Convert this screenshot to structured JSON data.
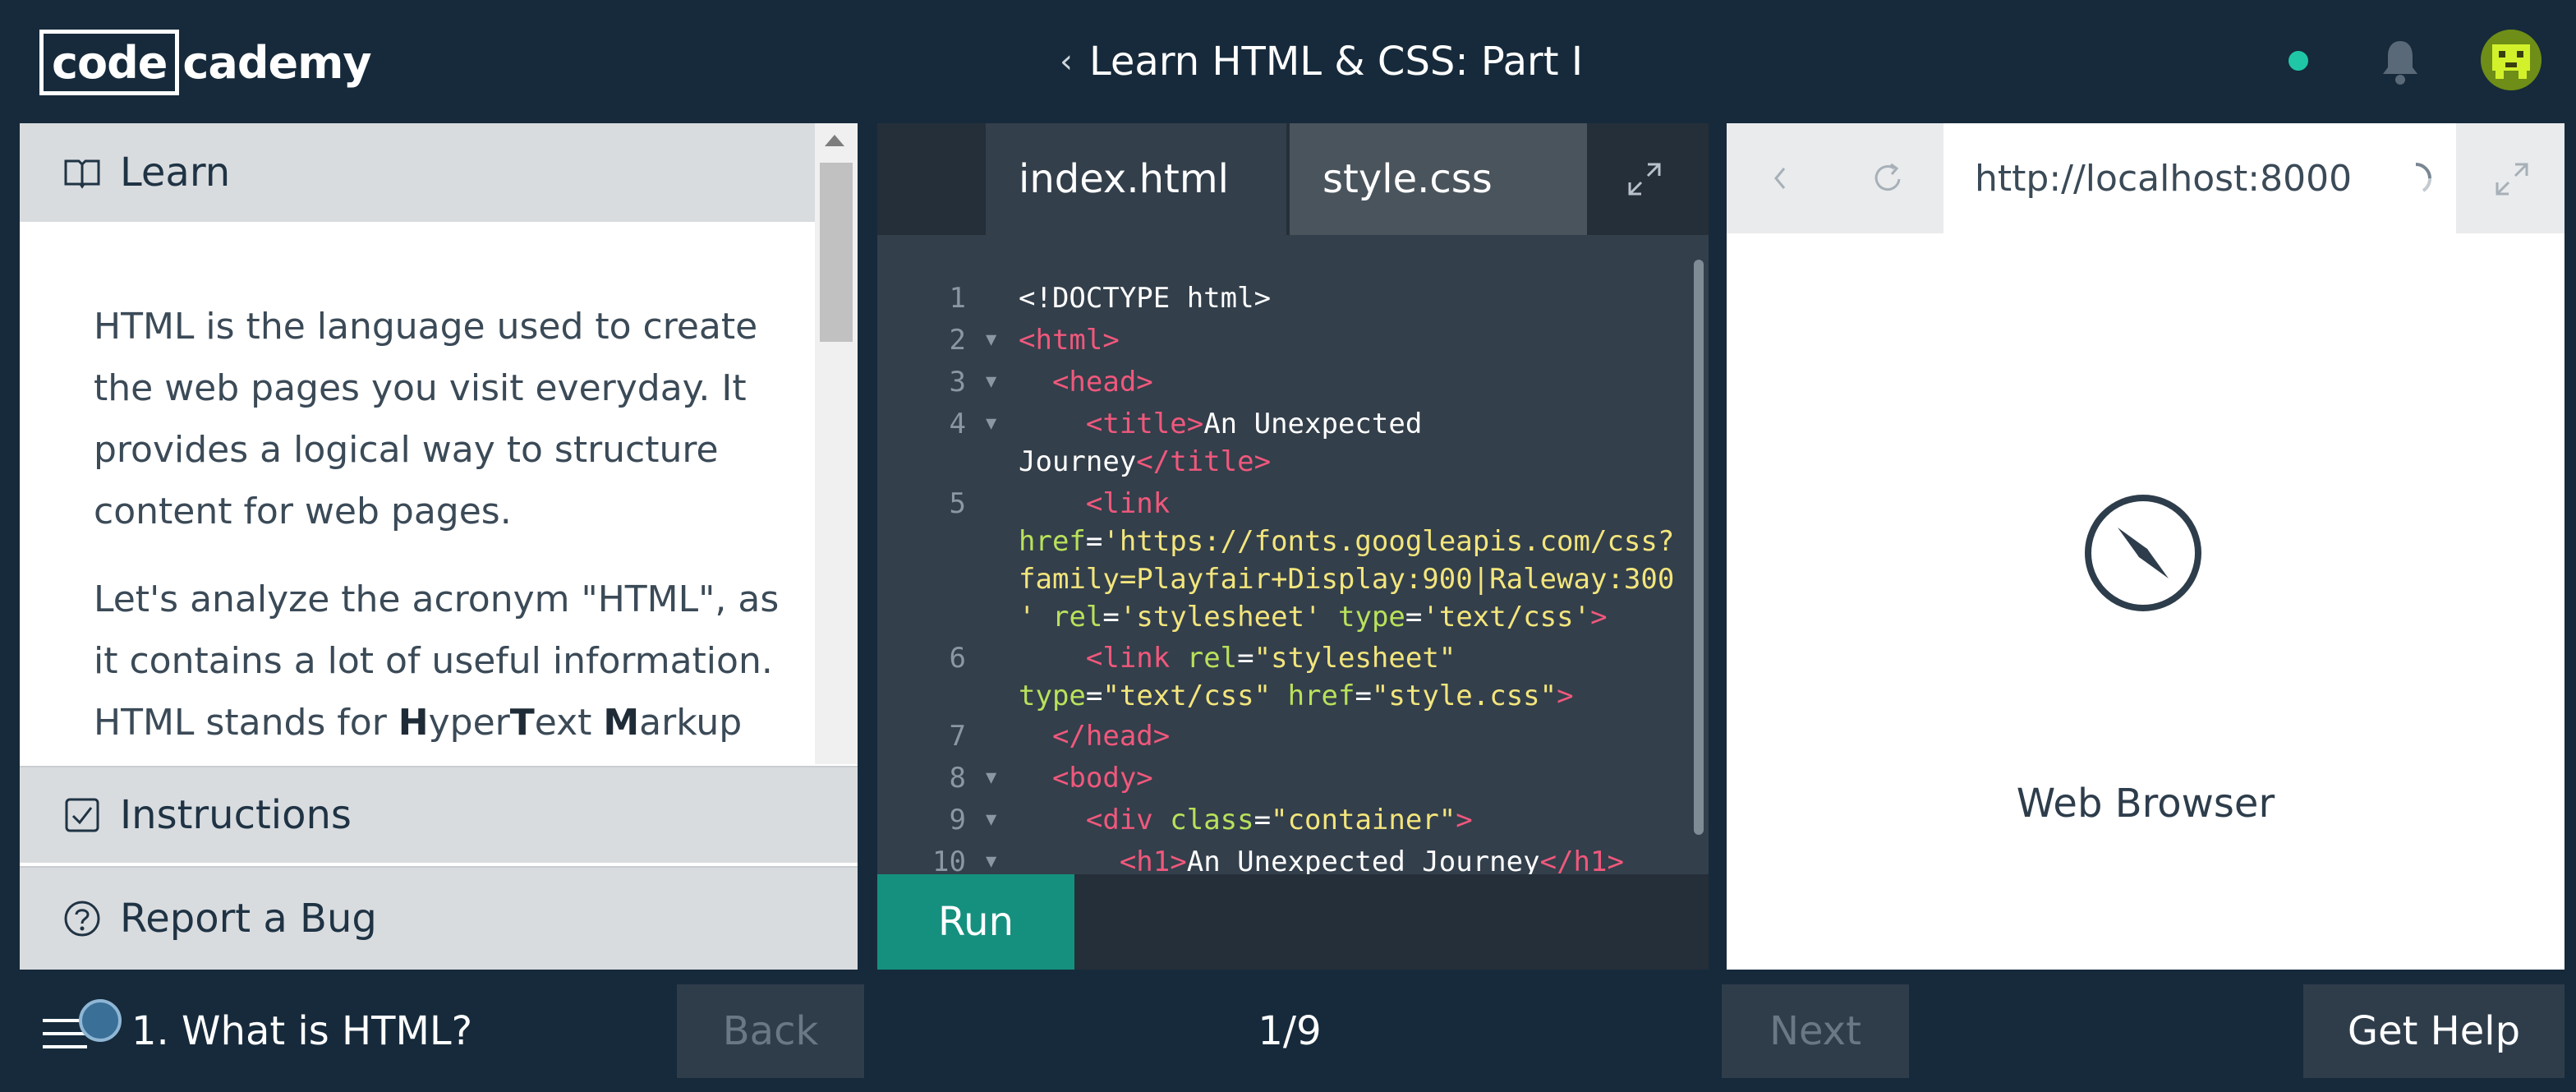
{
  "header": {
    "logo_boxed": "code",
    "logo_rest": "cademy",
    "course_title": "Learn HTML & CSS: Part I",
    "chevron": "‹",
    "icons": [
      "status-dot",
      "bell-icon",
      "avatar"
    ]
  },
  "lesson": {
    "learn_label": "Learn",
    "paragraph1": "HTML is the language used to create the web pages you visit everyday. It provides a logical way to structure content for web pages.",
    "paragraph2_start": "Let's analyze the acronym \"HTML\", as it contains a lot of useful information. HTML stands for ",
    "h": "H",
    "yper": "yper",
    "t": "T",
    "ext": "ext ",
    "m": "M",
    "arkup": "arkup",
    "instructions_label": "Instructions",
    "report_bug_label": "Report a Bug"
  },
  "editor": {
    "tabs": [
      "index.html",
      "style.css"
    ],
    "active_tab": "index.html",
    "run_label": "Run",
    "line_numbers": [
      "1",
      "2",
      "3",
      "4",
      "5",
      "6",
      "7",
      "8",
      "9",
      "10"
    ]
  },
  "browser": {
    "url": "http://localhost:8000",
    "label": "Web Browser"
  },
  "footer": {
    "lesson_title": "1. What is HTML?",
    "back_label": "Back",
    "progress": "1/9",
    "next_label": "Next",
    "help_label": "Get Help"
  },
  "colors": {
    "background": "#162a3b",
    "run_button": "#15907f",
    "status_dot": "#1fc7a7",
    "code_tag": "#f0587c",
    "code_attr": "#b9e15b",
    "code_string": "#f3e57c"
  }
}
